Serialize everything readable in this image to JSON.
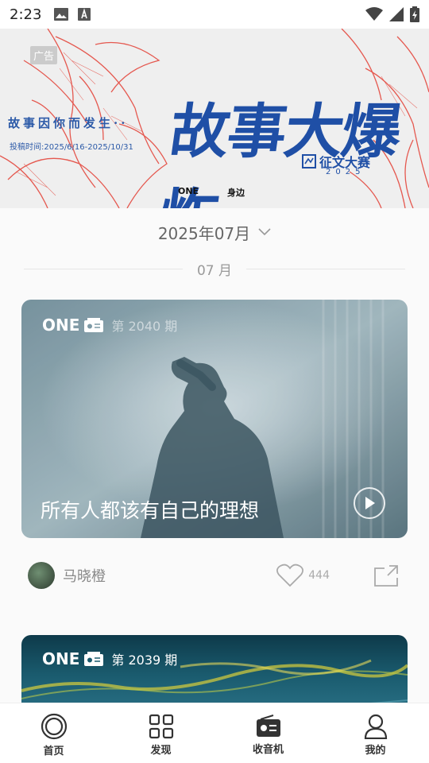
{
  "status_bar": {
    "time": "2:23"
  },
  "banner": {
    "ad_tag": "广告",
    "tagline": "故事因你而发生··",
    "dates": "投稿时间:2025/6/16-2025/10/31",
    "headline": "故事大爆炸",
    "contest_label": "征文大赛",
    "contest_year": "2025",
    "logo_one": "ONE",
    "logo_side": "身边"
  },
  "month_selector": {
    "label": "2025年07月"
  },
  "section": {
    "label": "07 月"
  },
  "cards": [
    {
      "brand": "ONE",
      "issue": "第 2040 期",
      "title": "所有人都该有自己的理想",
      "author": "马晓橙",
      "likes": "444"
    },
    {
      "brand": "ONE",
      "issue": "第 2039 期"
    }
  ],
  "tab_bar": {
    "tabs": [
      {
        "label": "首页",
        "icon": "home-circle-icon"
      },
      {
        "label": "发现",
        "icon": "grid-icon"
      },
      {
        "label": "收音机",
        "icon": "radio-icon"
      },
      {
        "label": "我的",
        "icon": "person-icon"
      }
    ]
  }
}
